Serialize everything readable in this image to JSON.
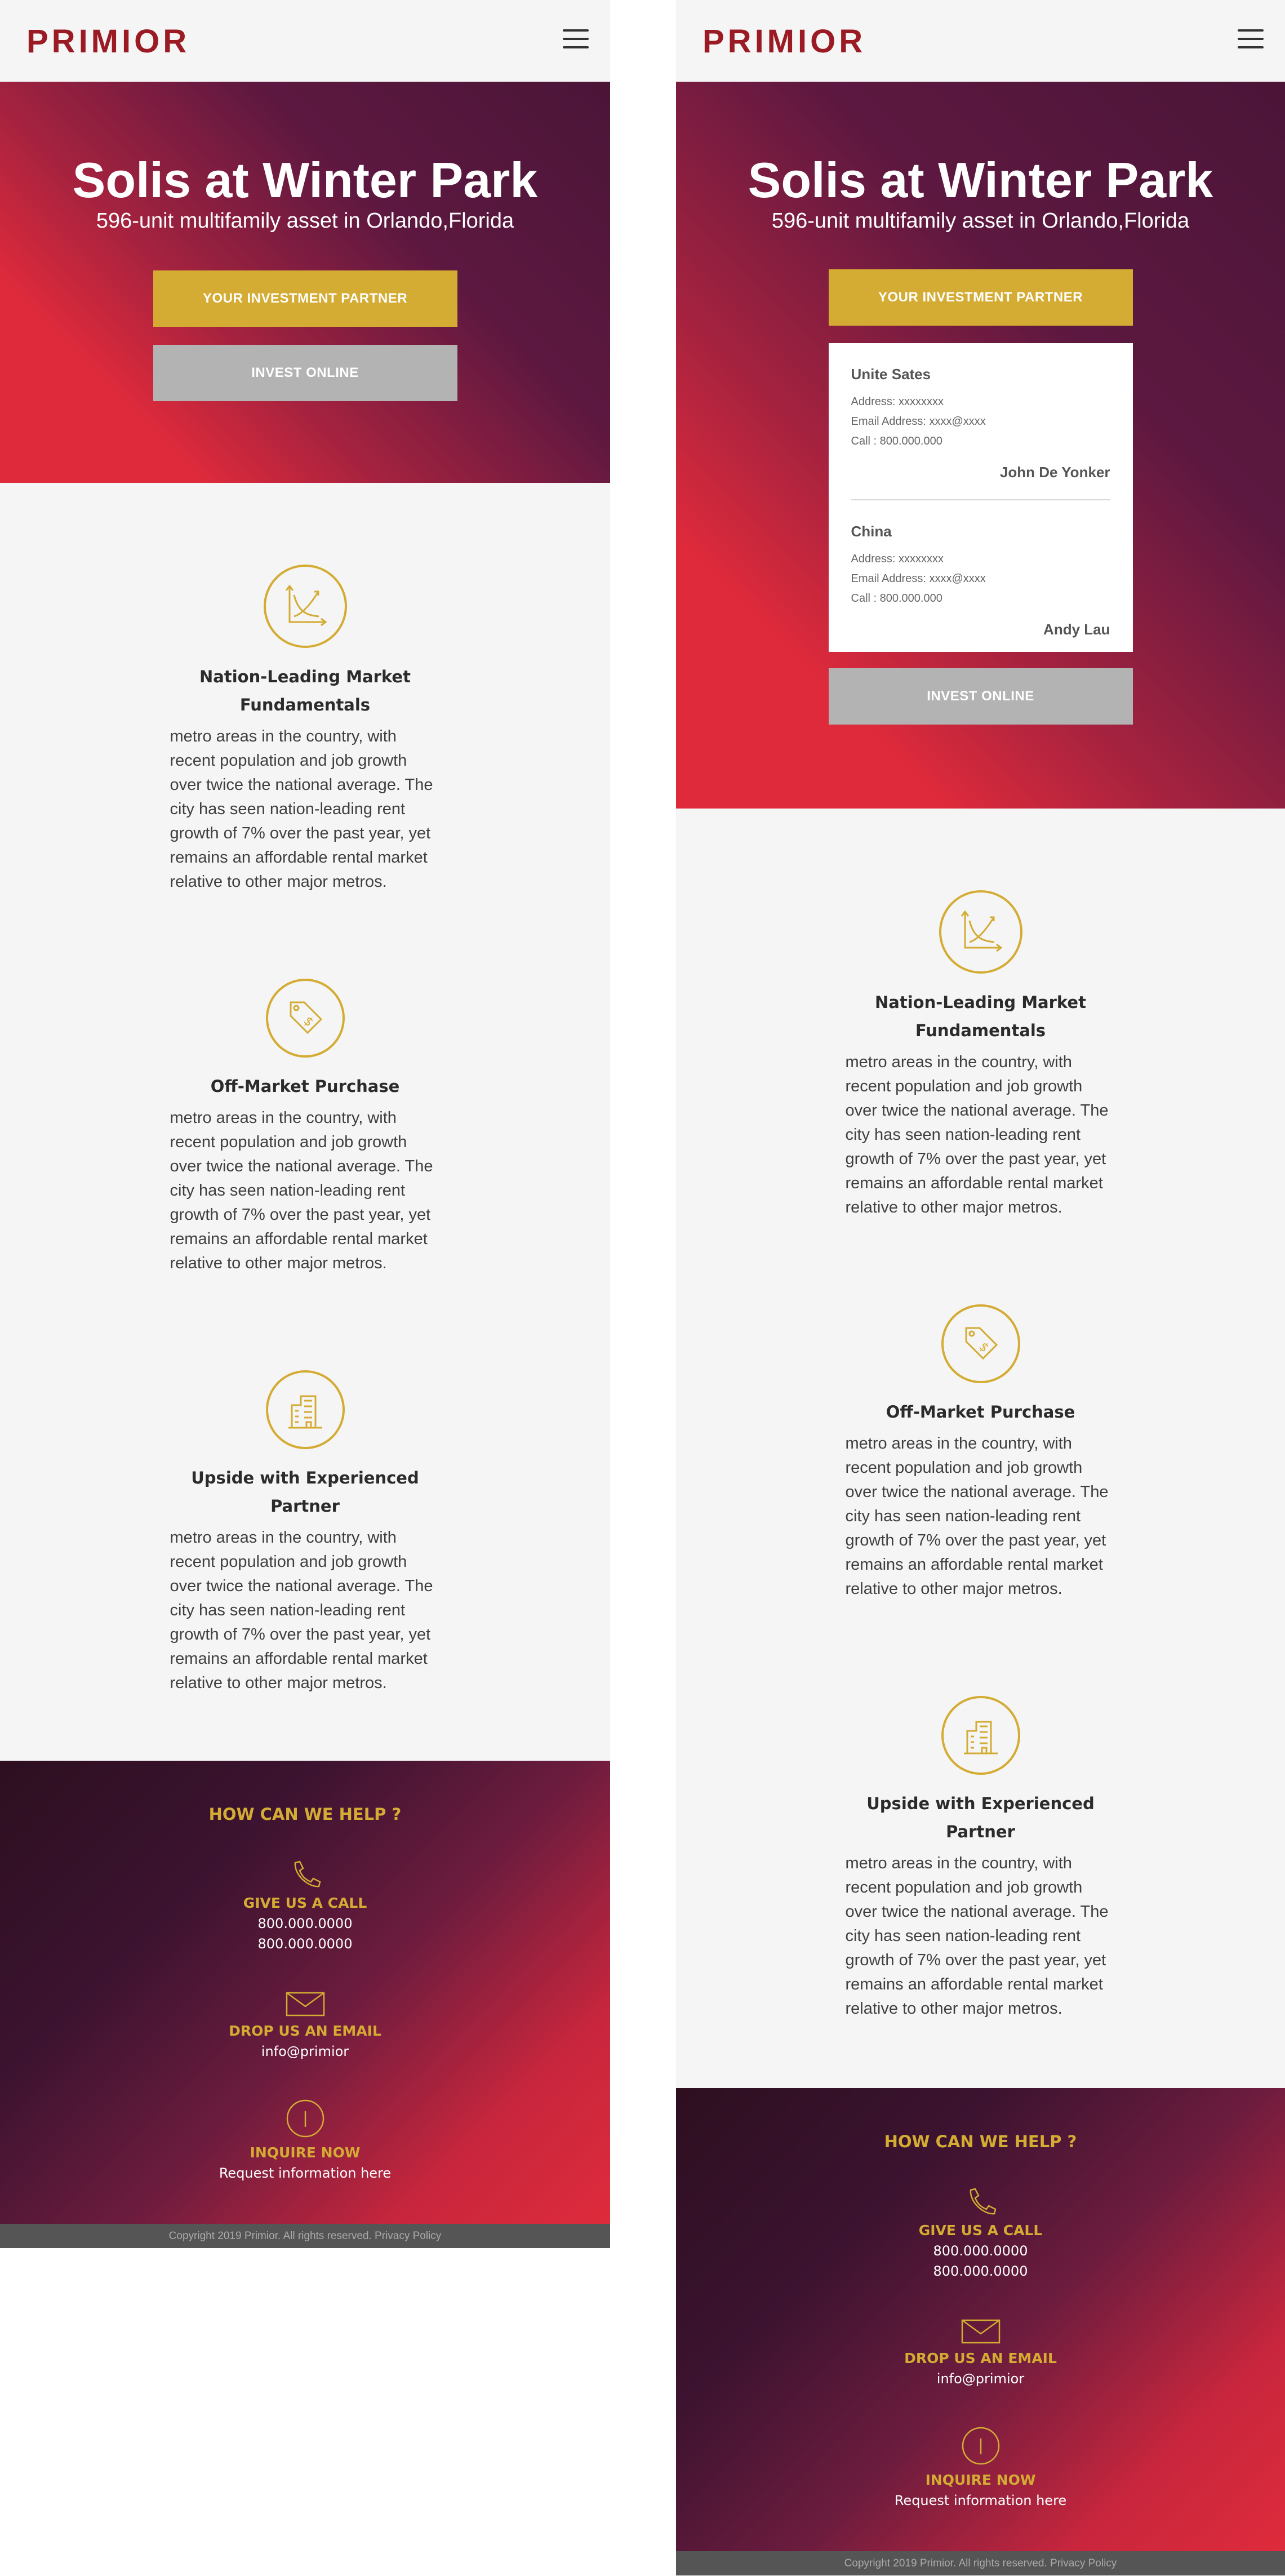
{
  "brand": {
    "logo": "PRIMIOR",
    "accent": "#d4ab33",
    "brand_red": "#9b1b25"
  },
  "menu": {
    "icon": "hamburger-menu-icon"
  },
  "hero": {
    "title": "Solis at Winter Park",
    "subtitle": "596-unit multifamily asset in Orlando,Florida",
    "partner_button": "YOUR INVESTMENT PARTNER",
    "invest_button": "INVEST ONLINE"
  },
  "offices": [
    {
      "name": "Unite Sates",
      "address": "Address: xxxxxxxx",
      "email": "Email Address: xxxx@xxxx",
      "call": "Call : 800.000.000",
      "person": "John De Yonker"
    },
    {
      "name": "China",
      "address": "Address: xxxxxxxx",
      "email": "Email Address: xxxx@xxxx",
      "call": "Call : 800.000.000",
      "person": "Andy Lau"
    }
  ],
  "features": [
    {
      "icon": "chart-trend-icon",
      "title": "Nation-Leading Market Fundamentals",
      "text": "metro areas in the country, with recent population and job growth over twice the national average. The city has seen nation-leading rent growth of 7% over the past year, yet remains an affordable rental market relative to other major metros."
    },
    {
      "icon": "price-tag-icon",
      "title": "Off-Market Purchase",
      "text": "metro areas in the country, with recent population and job growth over twice the national average. The city has seen nation-leading rent growth of 7% over the past year, yet remains an affordable rental market relative to other major metros."
    },
    {
      "icon": "building-icon",
      "title": "Upside with Experienced Partner",
      "text": "metro areas in the country, with recent population and job growth over twice the national average. The city has seen nation-leading rent growth of 7% over the past year, yet remains an affordable rental market relative to other major metros."
    }
  ],
  "footer": {
    "help_title": "HOW CAN WE HELP ?",
    "call_head": "GIVE US A CALL",
    "phone_1": "800.000.0000",
    "phone_2": "800.000.0000",
    "email_head": "DROP US AN EMAIL",
    "email": "info@primior",
    "inquire_head": "INQUIRE NOW",
    "inquire_text": "Request information here",
    "copyright": "Copyright 2019 Primior. All rights reserved. Privacy Policy"
  }
}
